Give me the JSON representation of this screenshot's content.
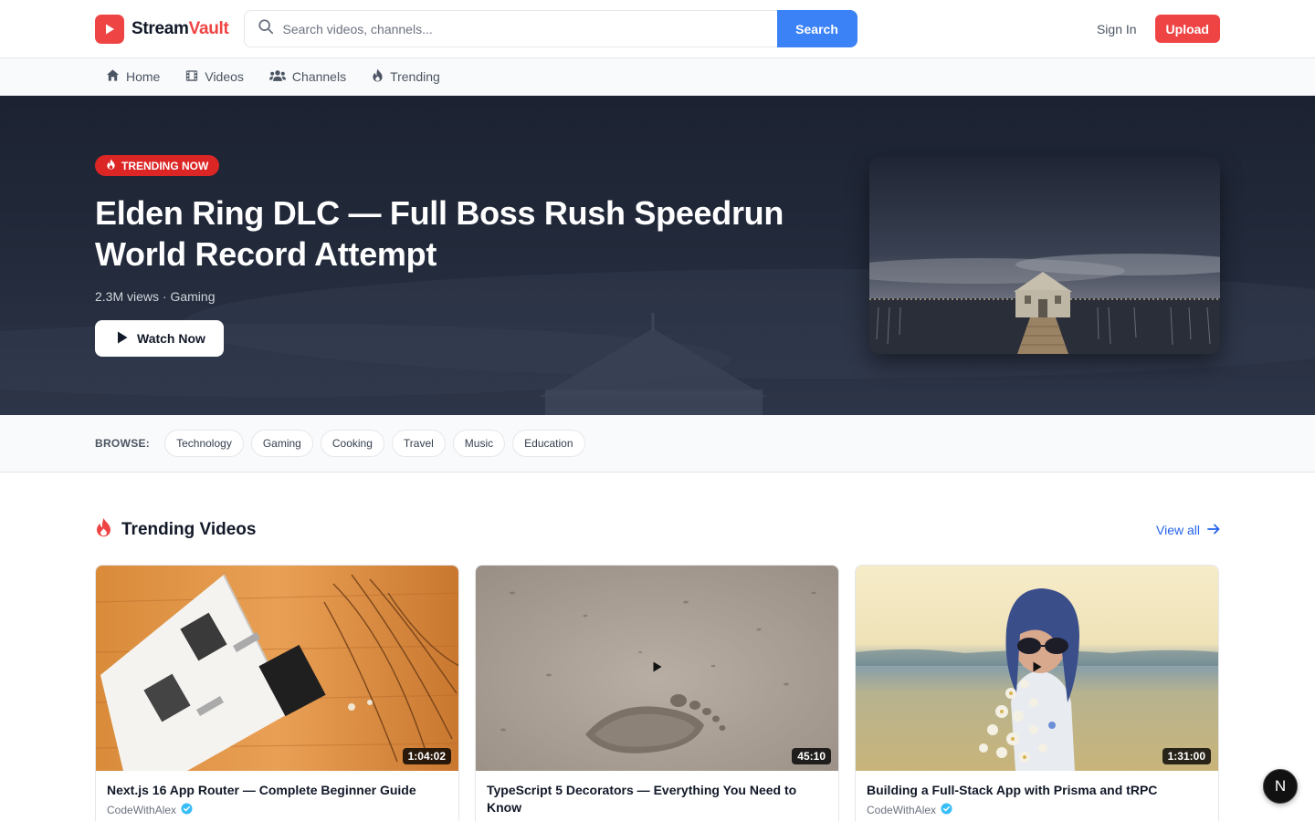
{
  "brand": {
    "name_part1": "Stream",
    "name_part2": "Vault",
    "accent_color": "#ef4444"
  },
  "search": {
    "placeholder": "Search videos, channels...",
    "button_label": "Search"
  },
  "header": {
    "signin_label": "Sign In",
    "upload_label": "Upload"
  },
  "nav": {
    "items": [
      {
        "label": "Home",
        "icon": "home-icon"
      },
      {
        "label": "Videos",
        "icon": "film-icon"
      },
      {
        "label": "Channels",
        "icon": "users-icon"
      },
      {
        "label": "Trending",
        "icon": "flame-icon"
      }
    ]
  },
  "hero": {
    "badge": "TRENDING NOW",
    "title_line1": "Elden Ring DLC — Full Boss Rush Speedrun",
    "title_line2": "World Record Attempt",
    "meta": "2.3M views · Gaming",
    "watch_label": "Watch Now"
  },
  "browse": {
    "label": "BROWSE:",
    "categories": [
      "Technology",
      "Gaming",
      "Cooking",
      "Travel",
      "Music",
      "Education"
    ]
  },
  "trending": {
    "title": "Trending Videos",
    "view_all": "View all",
    "videos": [
      {
        "title": "Next.js 16 App Router — Complete Beginner Guide",
        "channel": "CodeWithAlex",
        "duration": "1:04:02"
      },
      {
        "title": "TypeScript 5 Decorators — Everything You Need to Know",
        "channel": "",
        "duration": "45:10"
      },
      {
        "title": "Building a Full-Stack App with Prisma and tRPC",
        "channel": "CodeWithAlex",
        "duration": "1:31:00"
      }
    ]
  },
  "floating_badge": "N"
}
